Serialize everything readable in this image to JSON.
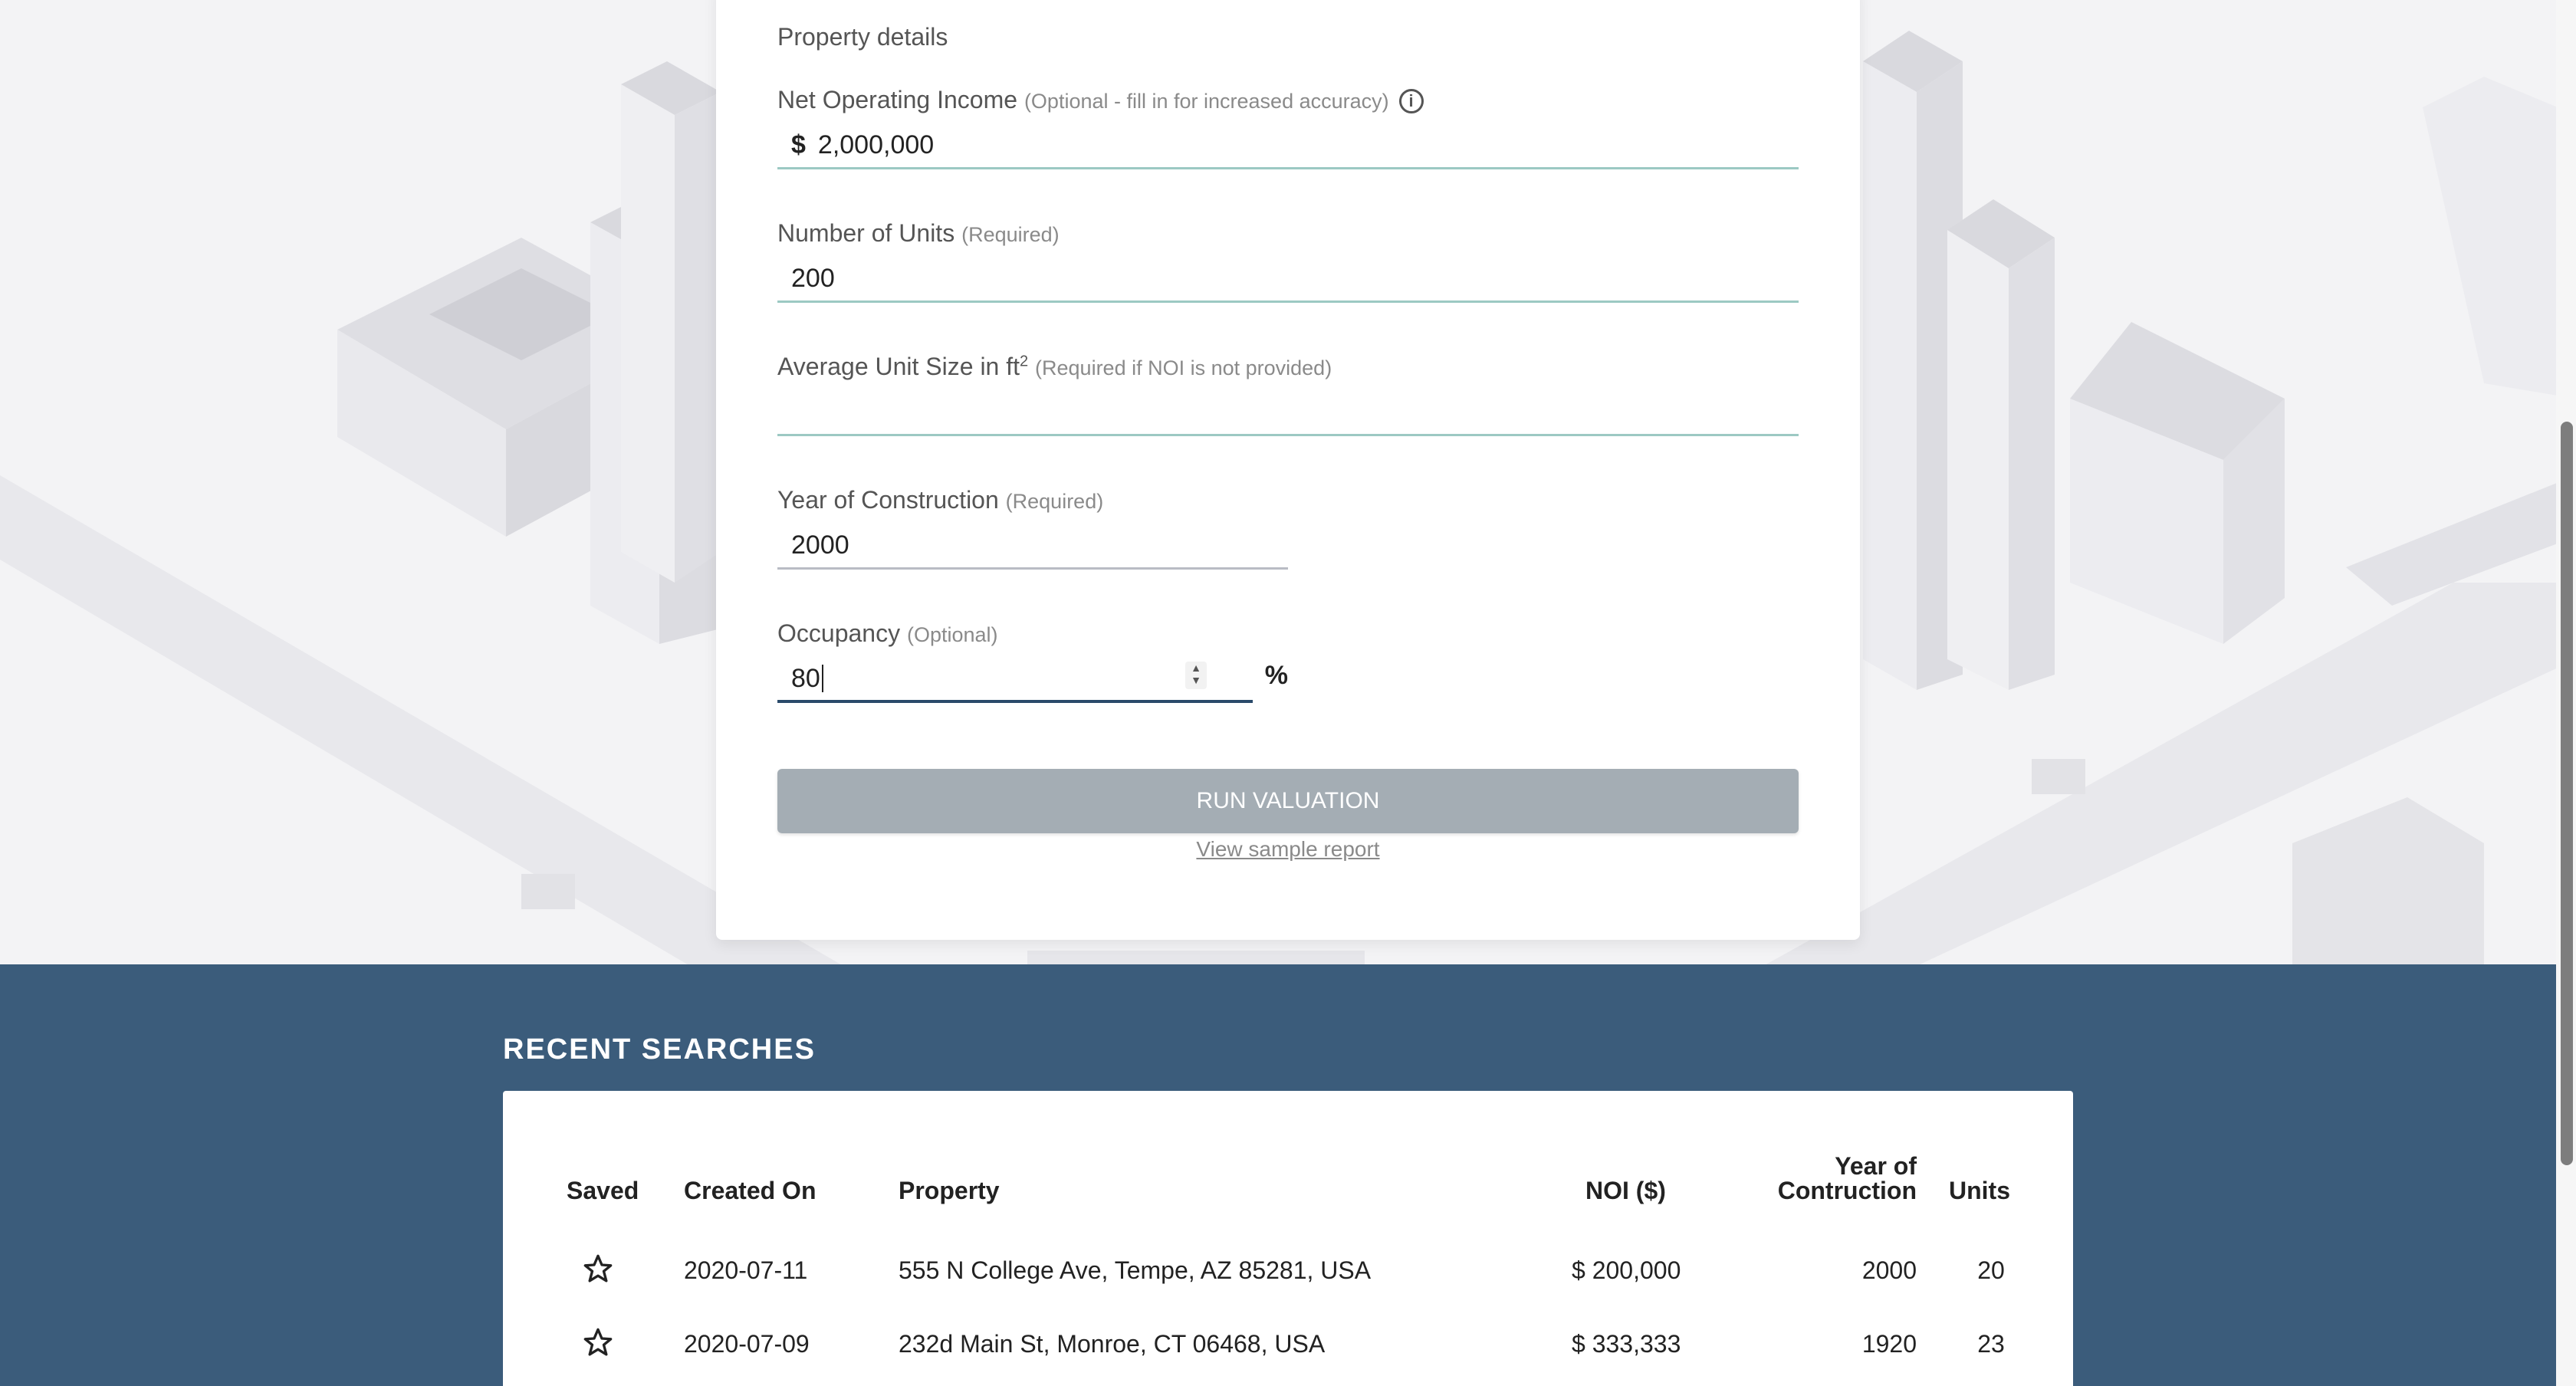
{
  "form": {
    "section_title": "Property details",
    "noi": {
      "label": "Net Operating Income",
      "hint": "(Optional - fill in for increased accuracy)",
      "prefix": "$",
      "value": "2,000,000"
    },
    "units": {
      "label": "Number of Units",
      "hint": "(Required)",
      "value": "200"
    },
    "unit_size": {
      "label": "Average Unit Size in ft",
      "label_sup": "2",
      "hint": "(Required if NOI is not provided)",
      "value": ""
    },
    "year": {
      "label": "Year of Construction",
      "hint": "(Required)",
      "value": "2000"
    },
    "occupancy": {
      "label": "Occupancy",
      "hint": "(Optional)",
      "value": "80",
      "suffix": "%"
    },
    "run_button": "RUN VALUATION",
    "sample_link": "View sample report"
  },
  "recent": {
    "title": "RECENT SEARCHES",
    "headers": {
      "saved": "Saved",
      "created": "Created On",
      "property": "Property",
      "noi": "NOI ($)",
      "year_line1": "Year of",
      "year_line2": "Contruction",
      "units": "Units"
    },
    "rows": [
      {
        "created": "2020-07-11",
        "property": "555 N College Ave, Tempe, AZ 85281, USA",
        "noi": "$ 200,000",
        "year": "2000",
        "units": "20"
      },
      {
        "created": "2020-07-09",
        "property": "232d Main St, Monroe, CT 06468, USA",
        "noi": "$ 333,333",
        "year": "1920",
        "units": "23"
      }
    ]
  },
  "colors": {
    "band": "#3b5c7b",
    "button": "#a4adb4",
    "input_underline": "#9cc9c3",
    "focus_underline": "#2a4a6a"
  }
}
